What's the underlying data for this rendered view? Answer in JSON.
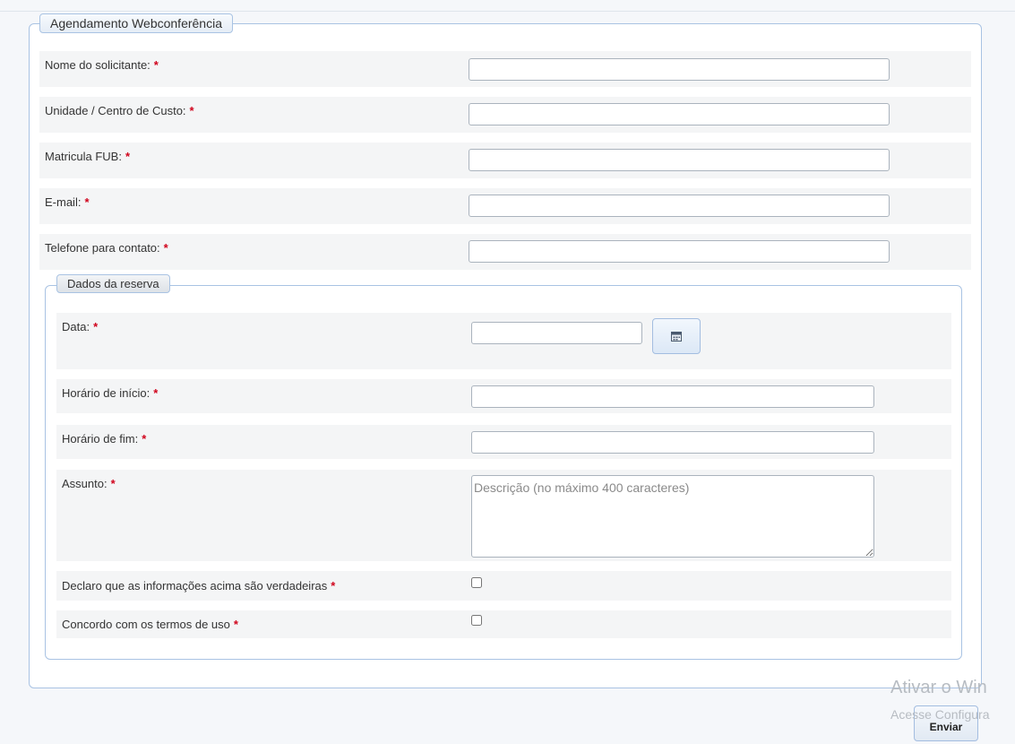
{
  "form": {
    "legend": "Agendamento Webconferência",
    "fields": {
      "nome": {
        "label": "Nome do solicitante:",
        "required": "*",
        "value": ""
      },
      "unidade": {
        "label": "Unidade / Centro de Custo:",
        "required": "*",
        "value": ""
      },
      "matricula": {
        "label": "Matricula FUB:",
        "required": "*",
        "value": ""
      },
      "email": {
        "label": "E-mail:",
        "required": "*",
        "value": ""
      },
      "telefone": {
        "label": "Telefone para contato:",
        "required": "*",
        "value": ""
      }
    },
    "reserva": {
      "legend": "Dados da reserva",
      "data": {
        "label": "Data:",
        "required": "*",
        "value": "",
        "calendar_icon": "calendar-icon"
      },
      "inicio": {
        "label": "Horário de início:",
        "required": "*",
        "value": ""
      },
      "fim": {
        "label": "Horário de fim:",
        "required": "*",
        "value": ""
      },
      "assunto": {
        "label": "Assunto:",
        "required": "*",
        "placeholder": "Descrição (no máximo 400 caracteres)",
        "value": ""
      },
      "declaro": {
        "label": "Declaro que as informações acima são verdadeiras",
        "required": "*",
        "checked": false
      },
      "termos": {
        "label": "Concordo com os termos de uso",
        "required": "*",
        "checked": false
      }
    },
    "submit_label": "Enviar"
  },
  "watermark": {
    "line1": "Ativar o Win",
    "line2": "Acesse Configura"
  },
  "colors": {
    "required": "#d0021b",
    "border_accent": "#a9c3e3",
    "row_background": "#f4f5f6"
  }
}
